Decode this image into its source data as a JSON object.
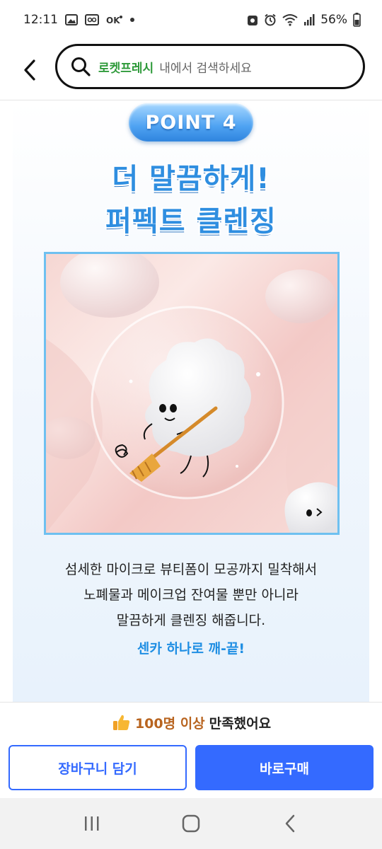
{
  "status_bar": {
    "time": "12:11",
    "battery": "56%"
  },
  "header": {
    "search_brand": "로켓프레시",
    "search_placeholder": "내에서 검색하세요"
  },
  "content": {
    "point_label": "POINT 4",
    "headline_line1": "더 말끔하게!",
    "headline_line2": "퍼펙트 클렌징",
    "description": [
      "섬세한 마이크로 뷰티폼이 모공까지 밀착해서",
      "노폐물과 메이크업 잔여물 뿐만 아니라",
      "말끔하게 클렌징 해줍니다."
    ],
    "tagline": "센카 하나로 깨-끝!"
  },
  "purchase_bar": {
    "satisfaction_count": "100명 이상",
    "satisfaction_suffix": "만족했어요",
    "cart_button": "장바구니 담기",
    "buy_button": "바로구매"
  },
  "colors": {
    "accent_blue": "#346aff",
    "headline_blue": "#2f8ee0",
    "brand_green": "#2e9a3a"
  }
}
